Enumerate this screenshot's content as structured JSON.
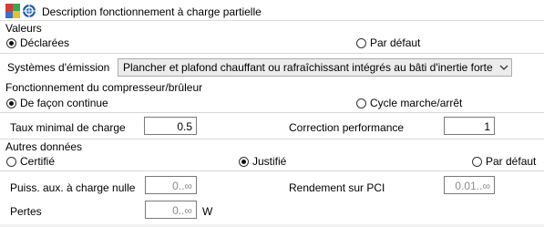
{
  "header": {
    "title": "Description fonctionnement à charge partielle"
  },
  "valeurs": {
    "group_label": "Valeurs",
    "option_declarees": "Déclarées",
    "option_par_defaut": "Par défaut",
    "selected": "declarees"
  },
  "emission": {
    "label": "Systèmes d'émission",
    "selected_value": "Plancher et plafond chauffant ou rafraîchissant intégrés au bâti d'inertie forte"
  },
  "compresseur": {
    "group_label": "Fonctionnement du compresseur/brûleur",
    "option_continue": "De façon continue",
    "option_cycle": "Cycle marche/arrêt",
    "selected": "continue"
  },
  "taux": {
    "label": "Taux minimal de charge",
    "value": "0.5"
  },
  "correction": {
    "label": "Correction performance",
    "value": "1"
  },
  "autres": {
    "group_label": "Autres données",
    "option_certifie": "Certifié",
    "option_justifie": "Justifié",
    "option_par_defaut": "Par défaut",
    "selected": "justifie"
  },
  "puissance": {
    "label": "Puiss. aux. à charge nulle",
    "placeholder": "0..∞"
  },
  "rendement": {
    "label": "Rendement sur PCI",
    "placeholder": "0.01..∞"
  },
  "pertes": {
    "label": "Pertes",
    "placeholder": "0..∞",
    "unit": "W"
  },
  "colors": {
    "logo_blue": "#3b6fd0",
    "logo_red": "#d63a3a",
    "logo_green": "#3aa84a",
    "logo_yellow": "#e6c12a"
  },
  "icons": {
    "logo": "app-logo-icon",
    "dropdown": "chevron-down-icon"
  }
}
